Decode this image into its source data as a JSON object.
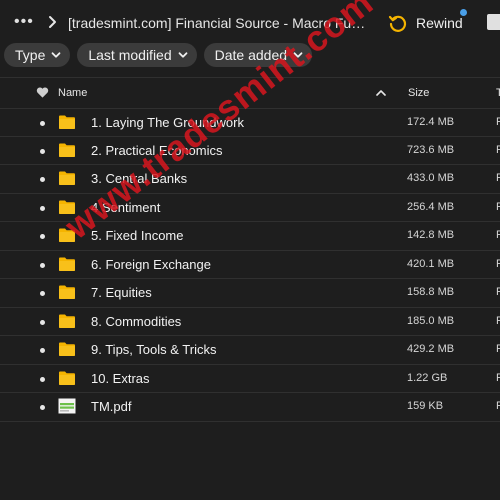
{
  "topbar": {
    "more_icon": "more-dots-icon",
    "breadcrumb": "[tradesmint.com] Financial Source - Macro Fun...",
    "rewind_label": "Rewind",
    "rewind_color": "#f5b400",
    "notif_color": "#4a9fe8"
  },
  "filters": {
    "type_label": "Type",
    "last_modified_label": "Last modified",
    "date_added_label": "Date added"
  },
  "table": {
    "name_header": "Name",
    "size_header": "Size",
    "type_header": "T",
    "rows": [
      {
        "icon": "folder-icon",
        "name": "1. Laying The Groundwork",
        "size": "172.4 MB",
        "type": "F"
      },
      {
        "icon": "folder-icon",
        "name": "2. Practical Economics",
        "size": "723.6 MB",
        "type": "F"
      },
      {
        "icon": "folder-icon",
        "name": "3. Central Banks",
        "size": "433.0 MB",
        "type": "F"
      },
      {
        "icon": "folder-icon",
        "name": "4 Sentiment",
        "size": "256.4 MB",
        "type": "F"
      },
      {
        "icon": "folder-icon",
        "name": "5. Fixed Income",
        "size": "142.8 MB",
        "type": "F"
      },
      {
        "icon": "folder-icon",
        "name": "6. Foreign Exchange",
        "size": "420.1 MB",
        "type": "F"
      },
      {
        "icon": "folder-icon",
        "name": "7. Equities",
        "size": "158.8 MB",
        "type": "F"
      },
      {
        "icon": "folder-icon",
        "name": "8. Commodities",
        "size": "185.0 MB",
        "type": "F"
      },
      {
        "icon": "folder-icon",
        "name": "9. Tips, Tools & Tricks",
        "size": "429.2 MB",
        "type": "F"
      },
      {
        "icon": "folder-icon",
        "name": "10. Extras",
        "size": "1.22 GB",
        "type": "F"
      },
      {
        "icon": "pdf-file-icon",
        "name": "TM.pdf",
        "size": "159 KB",
        "type": "F"
      }
    ]
  },
  "watermark": "www.tradesmint.com",
  "colors": {
    "background": "#1e1e1e",
    "folder": "#f5b400",
    "chip": "#3b3b3b",
    "watermark": "#d7161e"
  }
}
